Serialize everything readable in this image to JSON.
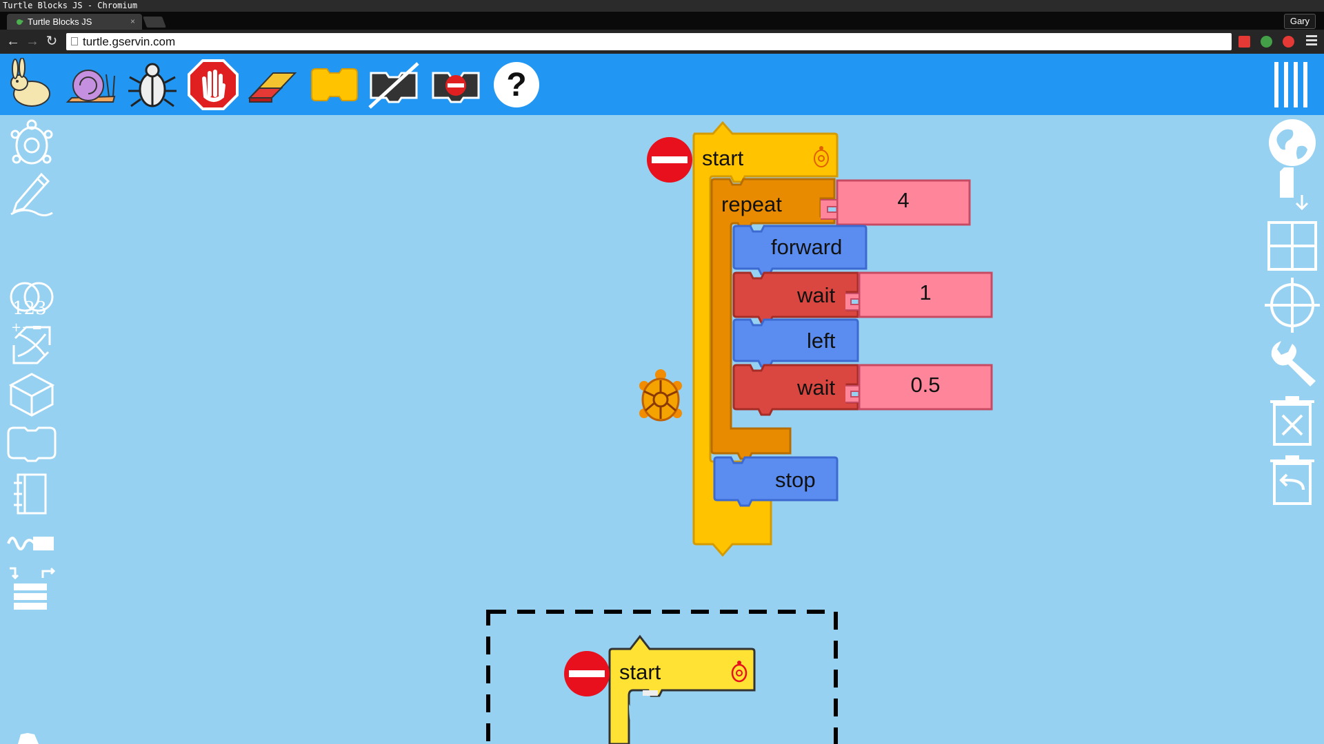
{
  "window": {
    "title": "Turtle Blocks JS - Chromium"
  },
  "browser": {
    "tab_title": "Turtle Blocks JS",
    "tab_close": "×",
    "profile": "Gary",
    "url": "turtle.gservin.com"
  },
  "toolbar": {
    "buttons": [
      "run-fast",
      "run-slow",
      "run-step",
      "stop",
      "clear",
      "hide-blocks",
      "collapse-blocks",
      "delete-blocks",
      "help"
    ]
  },
  "palettes": {
    "left": [
      "turtle",
      "pen",
      "number",
      "boolean",
      "flow",
      "action",
      "media",
      "sensors",
      "heap",
      "extras"
    ],
    "number_label": "123",
    "number_ops": "+−="
  },
  "blocks": {
    "start_label": "start",
    "repeat_label": "repeat",
    "repeat_arg": "4",
    "forward_label": "forward",
    "wait1_label": "wait",
    "wait1_arg": "1",
    "left_label": "left",
    "wait2_label": "wait",
    "wait2_arg": "0.5",
    "stop_label": "stop",
    "trash_start_label": "start"
  },
  "colors": {
    "app_bg": "#96d1f2",
    "topbar": "#2196f3",
    "start_block": "#ffc300",
    "repeat_block": "#e98b00",
    "motion_block": "#5b8cf0",
    "wait_block": "#d94740",
    "number_arg": "#ff869a"
  }
}
